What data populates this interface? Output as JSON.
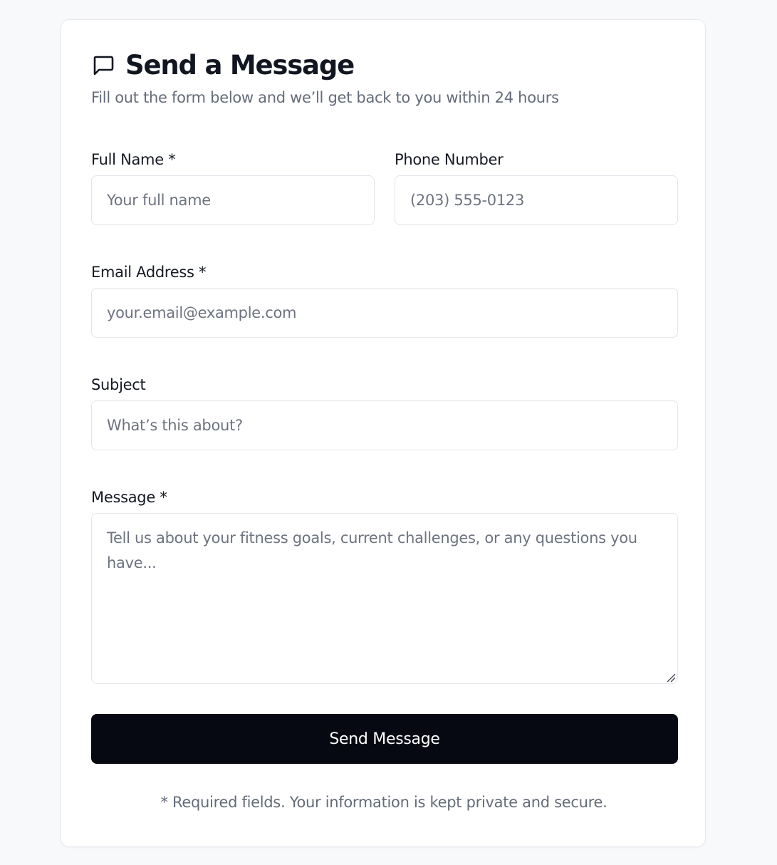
{
  "form": {
    "title": "Send a Message",
    "title_icon": "chat-bubble-icon",
    "subtitle": "Fill out the form below and we’ll get back to you within 24 hours",
    "fields": {
      "full_name": {
        "label": "Full Name *",
        "placeholder": "Your full name",
        "value": ""
      },
      "phone": {
        "label": "Phone Number",
        "placeholder": "(203) 555-0123",
        "value": ""
      },
      "email": {
        "label": "Email Address *",
        "placeholder": "your.email@example.com",
        "value": ""
      },
      "subject": {
        "label": "Subject",
        "placeholder": "What’s this about?",
        "value": ""
      },
      "message": {
        "label": "Message *",
        "placeholder": "Tell us about your fitness goals, current challenges, or any questions you have...",
        "value": ""
      }
    },
    "submit_label": "Send Message",
    "footnote": "* Required fields. Your information is kept private and secure."
  },
  "colors": {
    "page_background": "#f8f9fb",
    "card_background": "#ffffff",
    "button_background": "#060912",
    "button_text": "#ffffff",
    "muted_text": "#646b78",
    "border": "#e2e5ea"
  }
}
